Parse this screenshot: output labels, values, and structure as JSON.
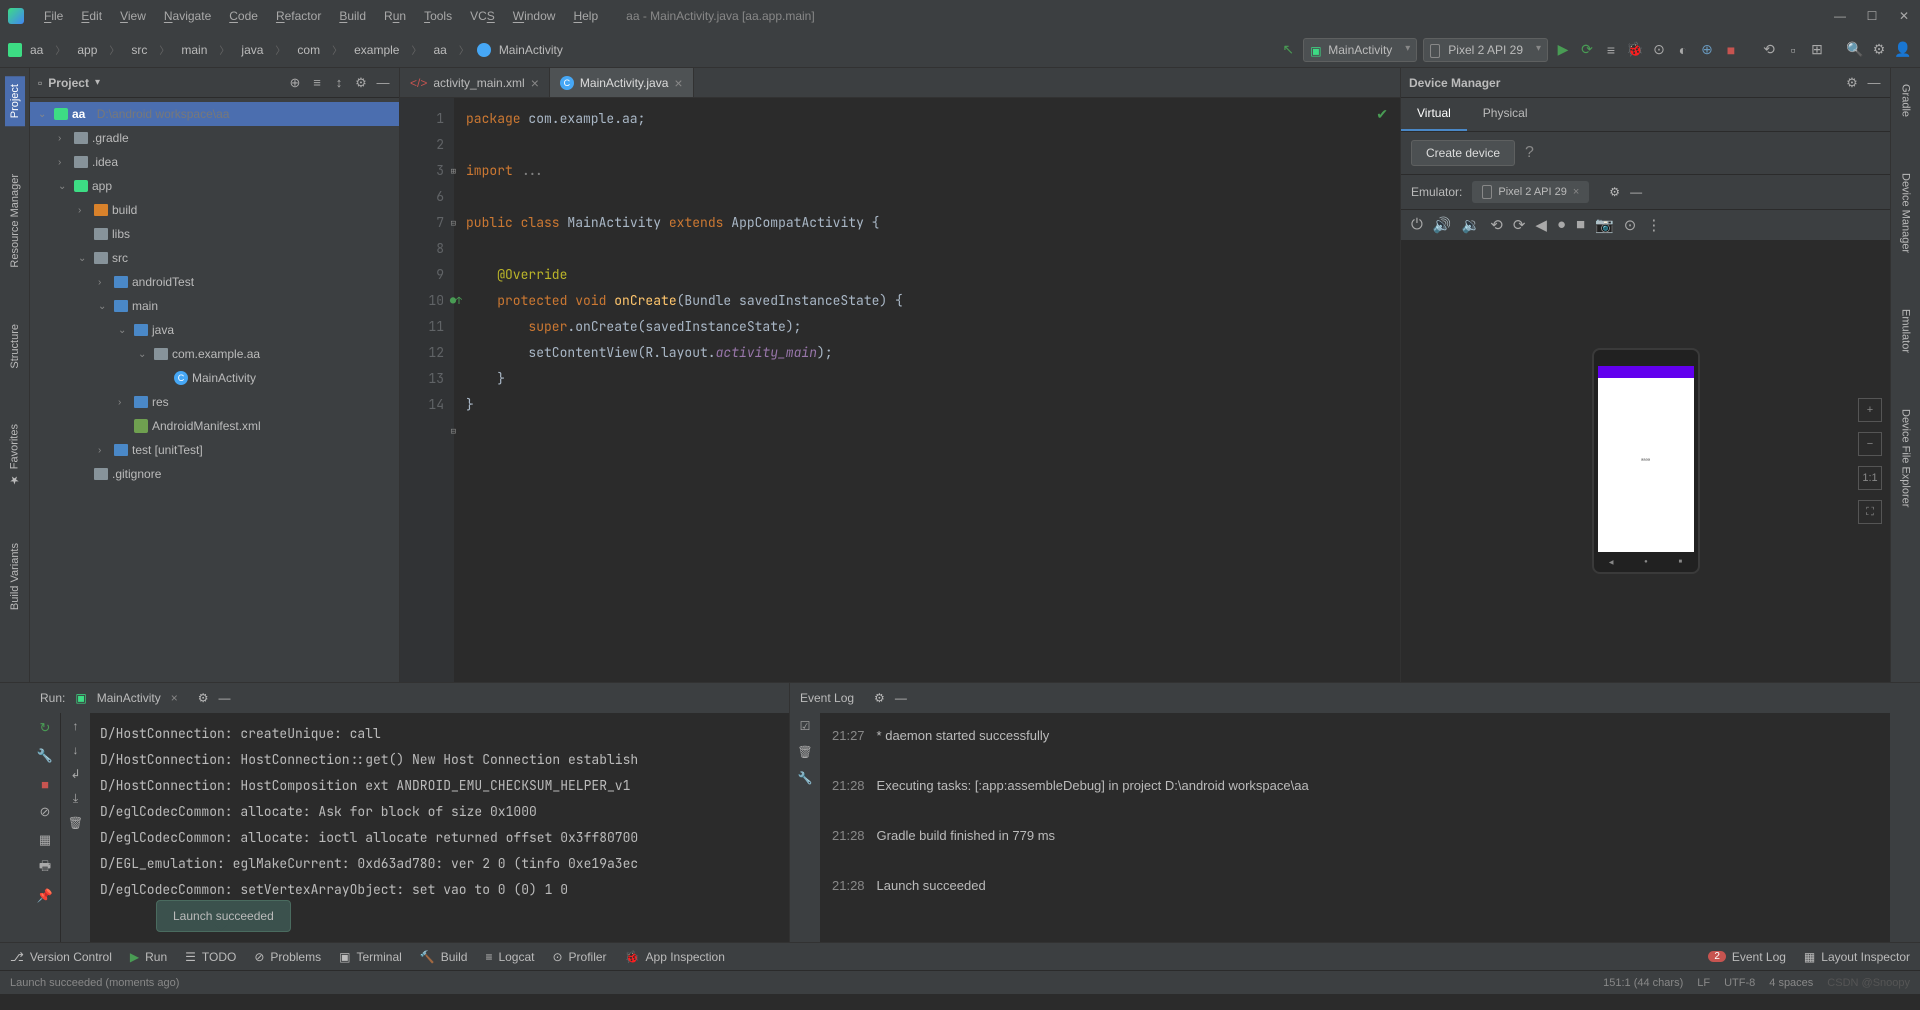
{
  "window": {
    "title": "aa - MainActivity.java [aa.app.main]"
  },
  "menus": [
    "File",
    "Edit",
    "View",
    "Navigate",
    "Code",
    "Refactor",
    "Build",
    "Run",
    "Tools",
    "VCS",
    "Window",
    "Help"
  ],
  "breadcrumb": [
    "aa",
    "app",
    "src",
    "main",
    "java",
    "com",
    "example",
    "aa",
    "MainActivity"
  ],
  "run_config": "MainActivity",
  "device_dropdown": "Pixel 2 API 29",
  "project": {
    "panel_title": "Project",
    "root": {
      "name": "aa",
      "path": "D:\\android workspace\\aa"
    },
    "items": [
      {
        "indent": 1,
        "icon": "folder",
        "name": ".gradle",
        "chev": "›"
      },
      {
        "indent": 1,
        "icon": "folder",
        "name": ".idea",
        "chev": "›"
      },
      {
        "indent": 1,
        "icon": "module",
        "name": "app",
        "chev": "⌄"
      },
      {
        "indent": 2,
        "icon": "folder-o",
        "name": "build",
        "chev": "›"
      },
      {
        "indent": 2,
        "icon": "folder",
        "name": "libs",
        "chev": ""
      },
      {
        "indent": 2,
        "icon": "folder",
        "name": "src",
        "chev": "⌄"
      },
      {
        "indent": 3,
        "icon": "folder-b",
        "name": "androidTest",
        "chev": "›"
      },
      {
        "indent": 3,
        "icon": "folder-b",
        "name": "main",
        "chev": "⌄"
      },
      {
        "indent": 4,
        "icon": "folder-b",
        "name": "java",
        "chev": "⌄"
      },
      {
        "indent": 5,
        "icon": "folder",
        "name": "com.example.aa",
        "chev": "⌄"
      },
      {
        "indent": 6,
        "icon": "class",
        "name": "MainActivity",
        "chev": ""
      },
      {
        "indent": 4,
        "icon": "folder-b",
        "name": "res",
        "chev": "›"
      },
      {
        "indent": 4,
        "icon": "xml",
        "name": "AndroidManifest.xml",
        "chev": ""
      },
      {
        "indent": 3,
        "icon": "folder-b",
        "name": "test [unitTest]",
        "chev": "›"
      },
      {
        "indent": 2,
        "icon": "file",
        "name": ".gitignore",
        "chev": ""
      }
    ]
  },
  "editor": {
    "tabs": [
      {
        "name": "activity_main.xml",
        "active": false
      },
      {
        "name": "MainActivity.java",
        "active": true
      }
    ],
    "lines": [
      "1",
      "2",
      "3",
      "6",
      "7",
      "8",
      "9",
      "10",
      "11",
      "12",
      "13",
      "14"
    ]
  },
  "device_manager": {
    "title": "Device Manager",
    "tabs": [
      "Virtual",
      "Physical"
    ],
    "create_btn": "Create device",
    "emulator_label": "Emulator:",
    "emulator_device": "Pixel 2 API 29"
  },
  "run": {
    "label": "Run:",
    "config": "MainActivity",
    "console": [
      "D/HostConnection: createUnique: call",
      "D/HostConnection: HostConnection::get() New Host Connection establish",
      "D/HostConnection: HostComposition ext ANDROID_EMU_CHECKSUM_HELPER_v1",
      "D/eglCodecCommon: allocate: Ask for block of size 0x1000",
      "D/eglCodecCommon: allocate: ioctl allocate returned offset 0x3ff80700",
      "D/EGL_emulation: eglMakeCurrent: 0xd63ad780: ver 2 0 (tinfo 0xe19a3ec",
      "D/eglCodecCommon: setVertexArrayObject: set vao to 0 (0) 1 0"
    ],
    "balloon": "Launch succeeded"
  },
  "eventlog": {
    "title": "Event Log",
    "entries": [
      {
        "time": "21:27",
        "msg": "* daemon started successfully"
      },
      {
        "time": "21:28",
        "msg": "Executing tasks: [:app:assembleDebug] in project D:\\android workspace\\aa"
      },
      {
        "time": "21:28",
        "msg": "Gradle build finished in 779 ms"
      },
      {
        "time": "21:28",
        "msg": "Launch succeeded"
      }
    ]
  },
  "bottom_bar": {
    "vc": "Version Control",
    "run": "Run",
    "todo": "TODO",
    "problems": "Problems",
    "terminal": "Terminal",
    "build": "Build",
    "logcat": "Logcat",
    "profiler": "Profiler",
    "app_inspection": "App Inspection",
    "event_log": "Event Log",
    "event_badge": "2",
    "layout_inspector": "Layout Inspector"
  },
  "status": {
    "left": "Launch succeeded (moments ago)",
    "pos": "151:1 (44 chars)",
    "enc": "LF",
    "charset": "UTF-8",
    "watermark": "CSDN @Snoopy"
  },
  "left_tabs": [
    "Project",
    "Resource Manager",
    "Structure",
    "Favorites",
    "Build Variants"
  ],
  "right_tabs": [
    "Gradle",
    "Device Manager",
    "Emulator",
    "Device File Explorer"
  ]
}
